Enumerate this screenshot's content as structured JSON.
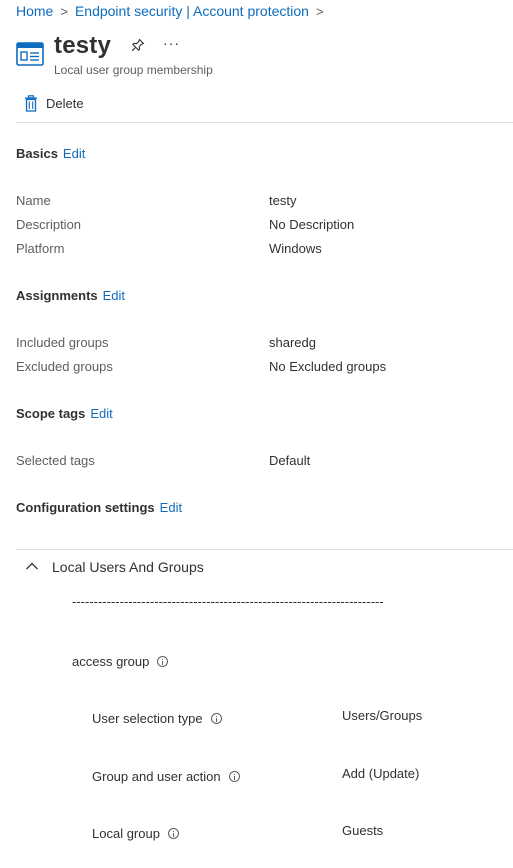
{
  "breadcrumb": {
    "items": [
      "Home",
      "Endpoint security | Account protection"
    ],
    "separator": ">"
  },
  "header": {
    "title": "testy",
    "subtitle": "Local user group membership",
    "more_label": "···"
  },
  "toolbar": {
    "delete_label": "Delete"
  },
  "basics": {
    "heading": "Basics",
    "edit_label": "Edit",
    "rows": [
      {
        "label": "Name",
        "value": "testy"
      },
      {
        "label": "Description",
        "value": "No Description"
      },
      {
        "label": "Platform",
        "value": "Windows"
      }
    ]
  },
  "assignments": {
    "heading": "Assignments",
    "edit_label": "Edit",
    "rows": [
      {
        "label": "Included groups",
        "value": "sharedg"
      },
      {
        "label": "Excluded groups",
        "value": "No Excluded groups"
      }
    ]
  },
  "scope_tags": {
    "heading": "Scope tags",
    "edit_label": "Edit",
    "rows": [
      {
        "label": "Selected tags",
        "value": "Default"
      }
    ]
  },
  "configuration": {
    "heading": "Configuration settings",
    "edit_label": "Edit",
    "group_title": "Local Users And Groups",
    "dashes": "------------------------------------------------------------------------",
    "access_group_label": "access group",
    "settings": [
      {
        "label": "User selection type",
        "value": "Users/Groups"
      },
      {
        "label": "Group and user action",
        "value": "Add (Update)"
      },
      {
        "label": "Local group",
        "value": "Guests"
      }
    ]
  },
  "colors": {
    "link": "#0f6cbd",
    "text": "#323130",
    "muted": "#605e5c",
    "divider": "#e1dfdd"
  }
}
